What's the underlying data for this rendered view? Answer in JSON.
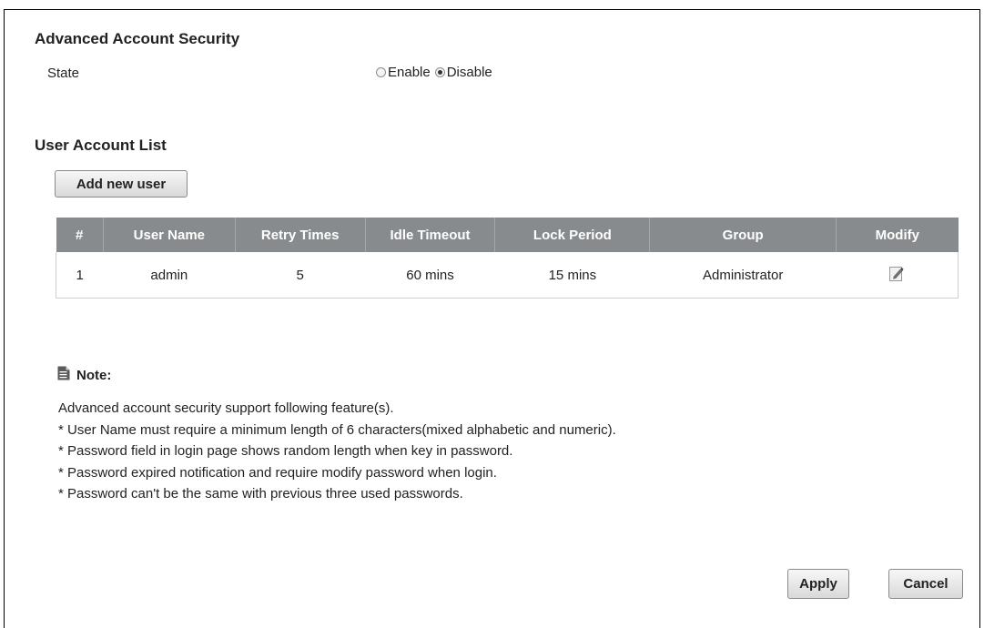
{
  "advanced_security": {
    "title": "Advanced Account Security",
    "state_label": "State",
    "options": [
      {
        "label": "Enable",
        "selected": false
      },
      {
        "label": "Disable",
        "selected": true
      }
    ]
  },
  "user_list": {
    "title": "User Account List",
    "add_button": "Add new user",
    "columns": [
      "#",
      "User Name",
      "Retry Times",
      "Idle Timeout",
      "Lock Period",
      "Group",
      "Modify"
    ],
    "rows": [
      {
        "index": "1",
        "user_name": "admin",
        "retry_times": "5",
        "idle_timeout": "60 mins",
        "lock_period": "15 mins",
        "group": "Administrator",
        "modify_icon": "edit-icon"
      }
    ]
  },
  "note": {
    "title": "Note:",
    "icon": "document-icon",
    "lines": [
      "Advanced account security support following feature(s).",
      "* User Name must require a minimum length of 6 characters(mixed alphabetic and numeric).",
      "* Password field in login page shows random length when key in password.",
      "* Password expired notification and require modify password when login.",
      "* Password can't be the same with previous three used passwords."
    ]
  },
  "actions": {
    "apply": "Apply",
    "cancel": "Cancel"
  },
  "colors": {
    "table_header_bg": "#888b8e",
    "table_header_text": "#ffffff",
    "button_border": "#8a8a8a"
  }
}
